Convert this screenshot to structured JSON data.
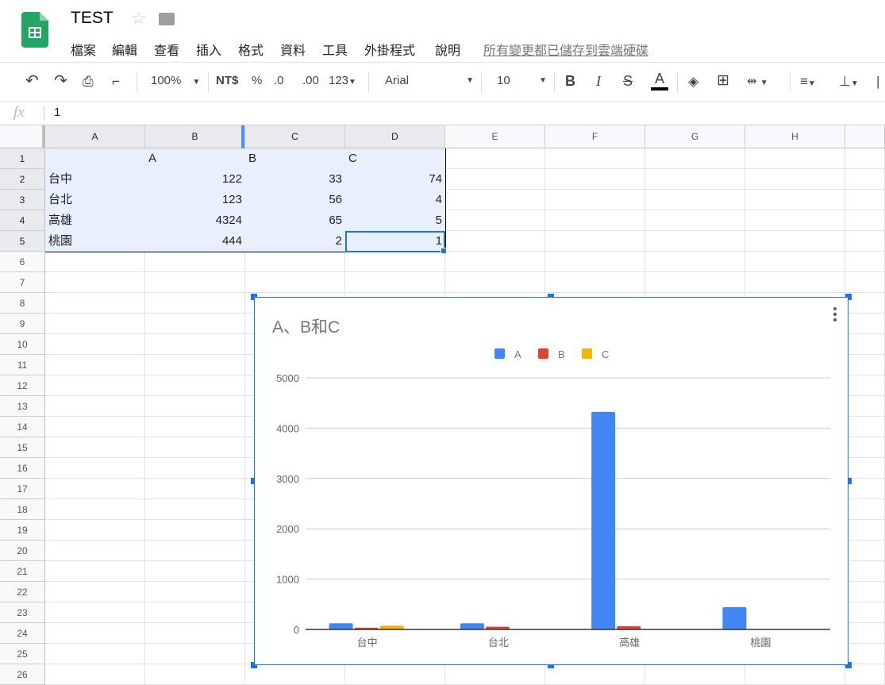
{
  "app": {
    "title": "TEST",
    "saved_status": "所有變更都已儲存到雲端硬碟"
  },
  "menu": [
    "檔案",
    "編輯",
    "查看",
    "插入",
    "格式",
    "資料",
    "工具",
    "外掛程式",
    "說明"
  ],
  "toolbar": {
    "zoom": "100%",
    "currency": "NT$",
    "percent": "%",
    "dec_less": ".0",
    "dec_more": ".00",
    "format": "123",
    "font": "Arial",
    "font_size": "10",
    "bold": "B",
    "italic": "I",
    "strike": "S",
    "text_color": "A",
    "text_color_value": "#000000"
  },
  "formula_bar": {
    "fx": "fx",
    "value": "1"
  },
  "columns": [
    "A",
    "B",
    "C",
    "D",
    "E",
    "F",
    "G",
    "H"
  ],
  "rows": [
    "1",
    "2",
    "3",
    "4",
    "5",
    "6",
    "7",
    "8",
    "9",
    "10",
    "11",
    "12",
    "13",
    "14",
    "15",
    "16",
    "17",
    "18",
    "19",
    "20",
    "21",
    "22",
    "23",
    "24",
    "25",
    "26"
  ],
  "table": [
    [
      "",
      "A",
      "B",
      "C"
    ],
    [
      "台中",
      "122",
      "33",
      "74"
    ],
    [
      "台北",
      "123",
      "56",
      "4"
    ],
    [
      "高雄",
      "4324",
      "65",
      "5"
    ],
    [
      "桃園",
      "444",
      "2",
      "1"
    ]
  ],
  "chart_data": {
    "type": "bar",
    "title": "A、B和C",
    "legend_position": "top",
    "categories": [
      "台中",
      "台北",
      "高雄",
      "桃園"
    ],
    "series": [
      {
        "name": "A",
        "color": "#4285f4",
        "values": [
          122,
          123,
          4324,
          444
        ]
      },
      {
        "name": "B",
        "color": "#db4437",
        "values": [
          33,
          56,
          65,
          2
        ]
      },
      {
        "name": "C",
        "color": "#f4b400",
        "values": [
          74,
          4,
          5,
          1
        ]
      }
    ],
    "ylim": [
      0,
      5000
    ],
    "yticks": [
      "0",
      "1000",
      "2000",
      "3000",
      "4000",
      "5000"
    ],
    "grid": true
  }
}
